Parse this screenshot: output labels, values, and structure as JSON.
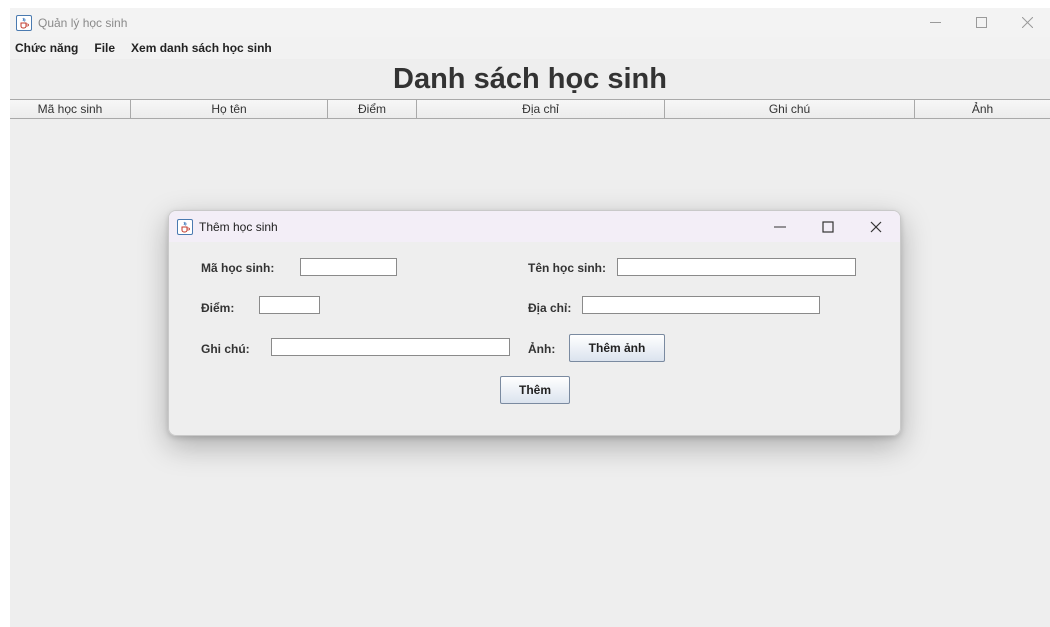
{
  "window": {
    "title": "Quản lý học sinh"
  },
  "menu": {
    "items": [
      "Chức năng",
      "File",
      "Xem danh sách học sinh"
    ]
  },
  "heading": "Danh sách học sinh",
  "table": {
    "columns": [
      "Mã học sinh",
      "Họ tên",
      "Điểm",
      "Địa chỉ",
      "Ghi chú",
      "Ảnh"
    ]
  },
  "dialog": {
    "title": "Thêm học sinh",
    "fields": {
      "ma_label": "Mã học sinh:",
      "ten_label": "Tên học sinh:",
      "diem_label": "Điểm:",
      "diachi_label": "Địa chỉ:",
      "ghichu_label": "Ghi chú:",
      "anh_label": "Ảnh:"
    },
    "values": {
      "ma": "",
      "ten": "",
      "diem": "",
      "diachi": "",
      "ghichu": ""
    },
    "buttons": {
      "them_anh": "Thêm ảnh",
      "them": "Thêm"
    }
  },
  "icons": {
    "app": "java-cup-icon",
    "minimize": "minimize-icon",
    "maximize": "maximize-icon",
    "close": "close-icon"
  }
}
